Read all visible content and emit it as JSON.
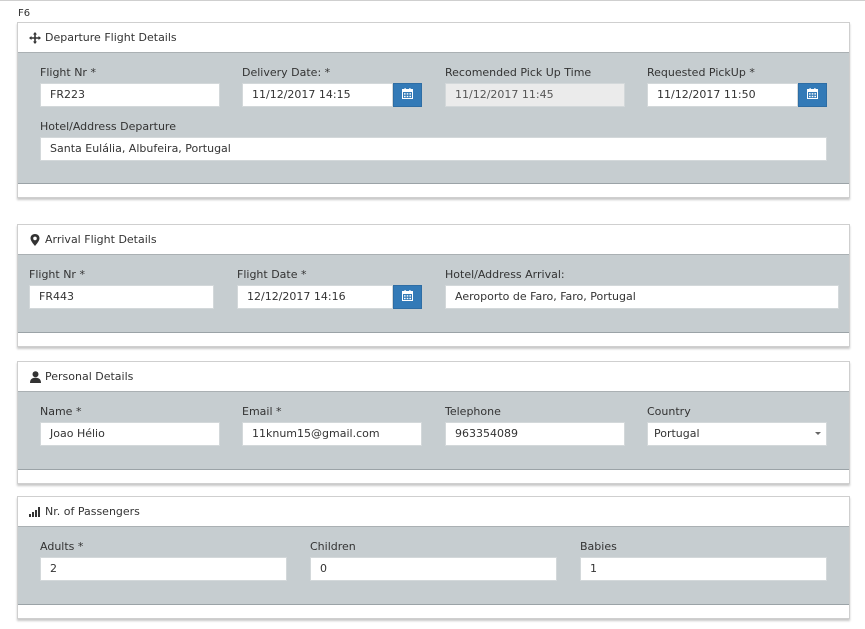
{
  "page": {
    "label": "F6"
  },
  "departure": {
    "title": "Departure Flight Details",
    "icon": "arrows-move-icon",
    "flight_nr": {
      "label": "Flight Nr *",
      "value": "FR223"
    },
    "delivery_date": {
      "label": "Delivery Date: *",
      "value": "11/12/2017 14:15"
    },
    "recommended_pickup": {
      "label": "Recomended Pick Up Time",
      "value": "11/12/2017 11:45"
    },
    "requested_pickup": {
      "label": "Requested PickUp *",
      "value": "11/12/2017 11:50"
    },
    "address": {
      "label": "Hotel/Address Departure",
      "value": "Santa Eulália, Albufeira, Portugal"
    }
  },
  "arrival": {
    "title": "Arrival Flight Details",
    "icon": "map-marker-icon",
    "flight_nr": {
      "label": "Flight Nr *",
      "value": "FR443"
    },
    "flight_date": {
      "label": "Flight Date *",
      "value": "12/12/2017 14:16"
    },
    "address": {
      "label": "Hotel/Address Arrival:",
      "value": "Aeroporto de Faro, Faro, Portugal"
    }
  },
  "personal": {
    "title": "Personal Details",
    "icon": "user-icon",
    "name": {
      "label": "Name *",
      "value": "Joao Hélio"
    },
    "email": {
      "label": "Email *",
      "value": "11knum15@gmail.com"
    },
    "telephone": {
      "label": "Telephone",
      "value": "963354089"
    },
    "country": {
      "label": "Country",
      "value": "Portugal"
    }
  },
  "passengers": {
    "title": "Nr. of Passengers",
    "icon": "signal-bars-icon",
    "adults": {
      "label": "Adults *",
      "value": "2"
    },
    "children": {
      "label": "Children",
      "value": "0"
    },
    "babies": {
      "label": "Babies",
      "value": "1"
    }
  },
  "colors": {
    "accent": "#337ab7",
    "panel_body": "#c6cdd0"
  }
}
